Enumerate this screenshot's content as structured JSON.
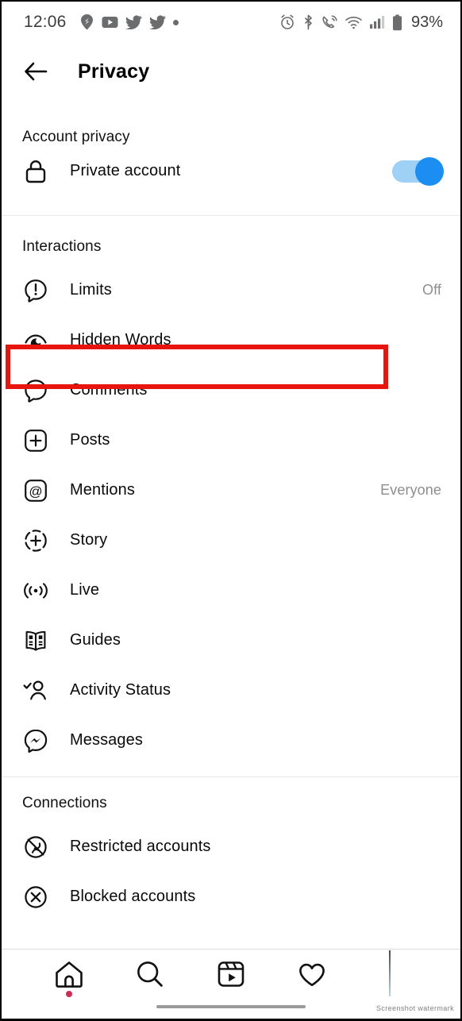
{
  "status_bar": {
    "time": "12:06",
    "left_icons": [
      "pin-icon",
      "youtube-icon",
      "twitter-icon",
      "twitter-icon",
      "dot-icon"
    ],
    "right_icons": [
      "alarm-icon",
      "bluetooth-icon",
      "wifi-calling-icon",
      "wifi-icon",
      "signal-icon",
      "battery-icon"
    ],
    "battery_percent": "93%"
  },
  "header": {
    "back_label": "Back",
    "title": "Privacy"
  },
  "sections": [
    {
      "title": "Account privacy",
      "rows": [
        {
          "icon": "lock-icon",
          "label": "Private account",
          "value": "",
          "control": "toggle",
          "toggle_on": true
        }
      ]
    },
    {
      "title": "Interactions",
      "rows": [
        {
          "icon": "limits-icon",
          "label": "Limits",
          "value": "Off",
          "control": "none"
        },
        {
          "icon": "hidden-words-icon",
          "label": "Hidden Words",
          "value": "",
          "control": "none",
          "highlighted": true
        },
        {
          "icon": "comments-icon",
          "label": "Comments",
          "value": "",
          "control": "none"
        },
        {
          "icon": "posts-icon",
          "label": "Posts",
          "value": "",
          "control": "none"
        },
        {
          "icon": "mentions-icon",
          "label": "Mentions",
          "value": "Everyone",
          "control": "none"
        },
        {
          "icon": "story-icon",
          "label": "Story",
          "value": "",
          "control": "none"
        },
        {
          "icon": "live-icon",
          "label": "Live",
          "value": "",
          "control": "none"
        },
        {
          "icon": "guides-icon",
          "label": "Guides",
          "value": "",
          "control": "none"
        },
        {
          "icon": "activity-status-icon",
          "label": "Activity Status",
          "value": "",
          "control": "none"
        },
        {
          "icon": "messages-icon",
          "label": "Messages",
          "value": "",
          "control": "none"
        }
      ]
    },
    {
      "title": "Connections",
      "rows": [
        {
          "icon": "restricted-accounts-icon",
          "label": "Restricted accounts",
          "value": "",
          "control": "none"
        },
        {
          "icon": "blocked-accounts-icon",
          "label": "Blocked accounts",
          "value": "",
          "control": "none"
        }
      ]
    }
  ],
  "bottom_nav": {
    "items": [
      {
        "icon": "home-icon",
        "label": "Home",
        "badge_dot": true
      },
      {
        "icon": "search-icon",
        "label": "Search",
        "badge_dot": false
      },
      {
        "icon": "reels-icon",
        "label": "Reels",
        "badge_dot": false
      },
      {
        "icon": "heart-icon",
        "label": "Activity",
        "badge_dot": false
      },
      {
        "icon": "profile-avatar",
        "label": "Profile",
        "badge_dot": false
      }
    ]
  },
  "annotation": {
    "target_label": "Hidden Words",
    "color": "#e8150f"
  },
  "watermark": {
    "text": "Screenshot watermark"
  },
  "colors": {
    "accent_blue": "#1c8ef2",
    "toggle_track": "#9fd0f5",
    "value_gray": "#8e8e8e",
    "divider": "#e8e8e8",
    "annotation_red": "#e8150f",
    "badge_red": "#cf2b54"
  }
}
